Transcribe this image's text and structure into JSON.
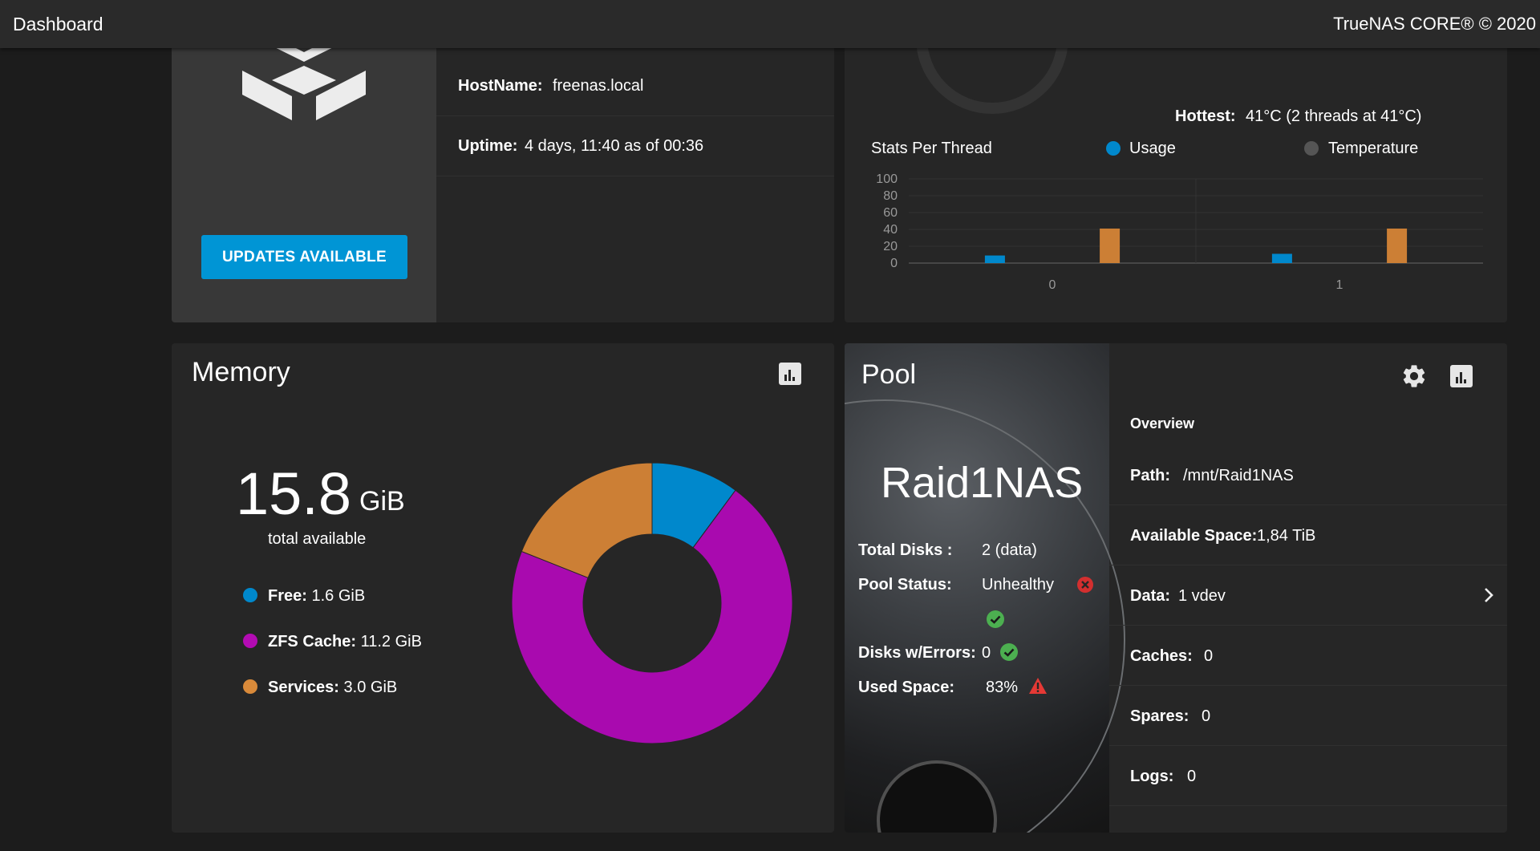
{
  "header": {
    "title": "Dashboard",
    "copyright": "TrueNAS CORE® © 2020"
  },
  "system": {
    "hostname_label": "HostName:",
    "hostname": "freenas.local",
    "uptime_label": "Uptime:",
    "uptime": "4 days, 11:40 as of 00:36",
    "update_button": "UPDATES AVAILABLE"
  },
  "cpu": {
    "hottest_label": "Hottest:",
    "hottest_value": "41°C  (2 threads at 41°C)",
    "stats_label": "Stats Per Thread",
    "colors": {
      "usage": "#0088cc",
      "temperature": "#cc7f35"
    },
    "chart_data": {
      "type": "bar",
      "categories": [
        "0",
        "1"
      ],
      "series": [
        {
          "name": "Usage",
          "values": [
            9,
            11
          ]
        },
        {
          "name": "Temperature",
          "values": [
            41,
            41
          ]
        }
      ],
      "ylim": [
        0,
        100
      ],
      "yticks": [
        "100",
        "80",
        "60",
        "40",
        "20",
        "0"
      ],
      "grid": true,
      "legend": "top"
    }
  },
  "memory": {
    "title": "Memory",
    "total_value": "15.8",
    "total_unit": "GiB",
    "total_caption": "total available",
    "legend": [
      {
        "label": "Free:",
        "value": "1.6 GiB",
        "color": "#0088cc"
      },
      {
        "label": "ZFS Cache:",
        "value": "11.2 GiB",
        "color": "#b30bb3"
      },
      {
        "label": "Services:",
        "value": "3.0 GiB",
        "color": "#d98a3a"
      }
    ],
    "chart_data": {
      "type": "pie",
      "categories": [
        "Free",
        "ZFS Cache",
        "Services"
      ],
      "values": [
        1.6,
        11.2,
        3.0
      ],
      "colors": [
        "#0088cc",
        "#a90aaf",
        "#cc7f35"
      ]
    }
  },
  "pool": {
    "title": "Pool",
    "name": "Raid1NAS",
    "total_disks_label": "Total Disks :",
    "total_disks": "2 (data)",
    "status_label": "Pool Status:",
    "status": "Unhealthy",
    "errors_label": "Disks w/Errors:",
    "errors": "0",
    "used_label": "Used Space:",
    "used": "83%",
    "overview_label": "Overview",
    "rows": [
      {
        "label": "Path:",
        "value": "/mnt/Raid1NAS"
      },
      {
        "label": "Available Space:",
        "value": "1,84 TiB"
      },
      {
        "label": "Data:",
        "value": "1 vdev"
      },
      {
        "label": "Caches:",
        "value": "0"
      },
      {
        "label": "Spares:",
        "value": "0"
      },
      {
        "label": "Logs:",
        "value": "0"
      }
    ],
    "colors": {
      "error": "#d32f2f",
      "ok": "#4caf50",
      "warning": "#e53935"
    }
  }
}
